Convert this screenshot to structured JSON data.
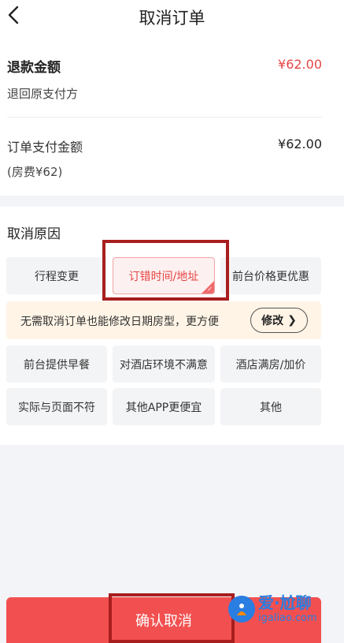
{
  "header": {
    "title": "取消订单",
    "back_icon": "chevron-left-icon"
  },
  "refund": {
    "label": "退款金额",
    "value": "¥62.00",
    "subtext": "退回原支付方",
    "value_color": "#e64545"
  },
  "payment": {
    "label": "订单支付金额",
    "value": "¥62.00",
    "subtext": "(房费¥62)"
  },
  "reasons": {
    "title": "取消原因",
    "items": [
      {
        "label": "行程变更",
        "selected": false
      },
      {
        "label": "订错时间/地址",
        "selected": true
      },
      {
        "label": "前台价格更优惠",
        "selected": false
      },
      {
        "label": "前台提供早餐",
        "selected": false
      },
      {
        "label": "对酒店环境不满意",
        "selected": false
      },
      {
        "label": "酒店满房/加价",
        "selected": false
      },
      {
        "label": "实际与页面不符",
        "selected": false
      },
      {
        "label": "其他APP更便宜",
        "selected": false
      },
      {
        "label": "其他",
        "selected": false
      }
    ],
    "tip": {
      "text": "无需取消订单也能修改日期房型，更方便",
      "button_label": "修改",
      "button_icon": "chevron-right-icon"
    }
  },
  "footer": {
    "confirm_label": "确认取消",
    "button_color": "#f25050"
  },
  "watermark": {
    "title": "爱·尬聊",
    "url": "igaliao.com"
  }
}
